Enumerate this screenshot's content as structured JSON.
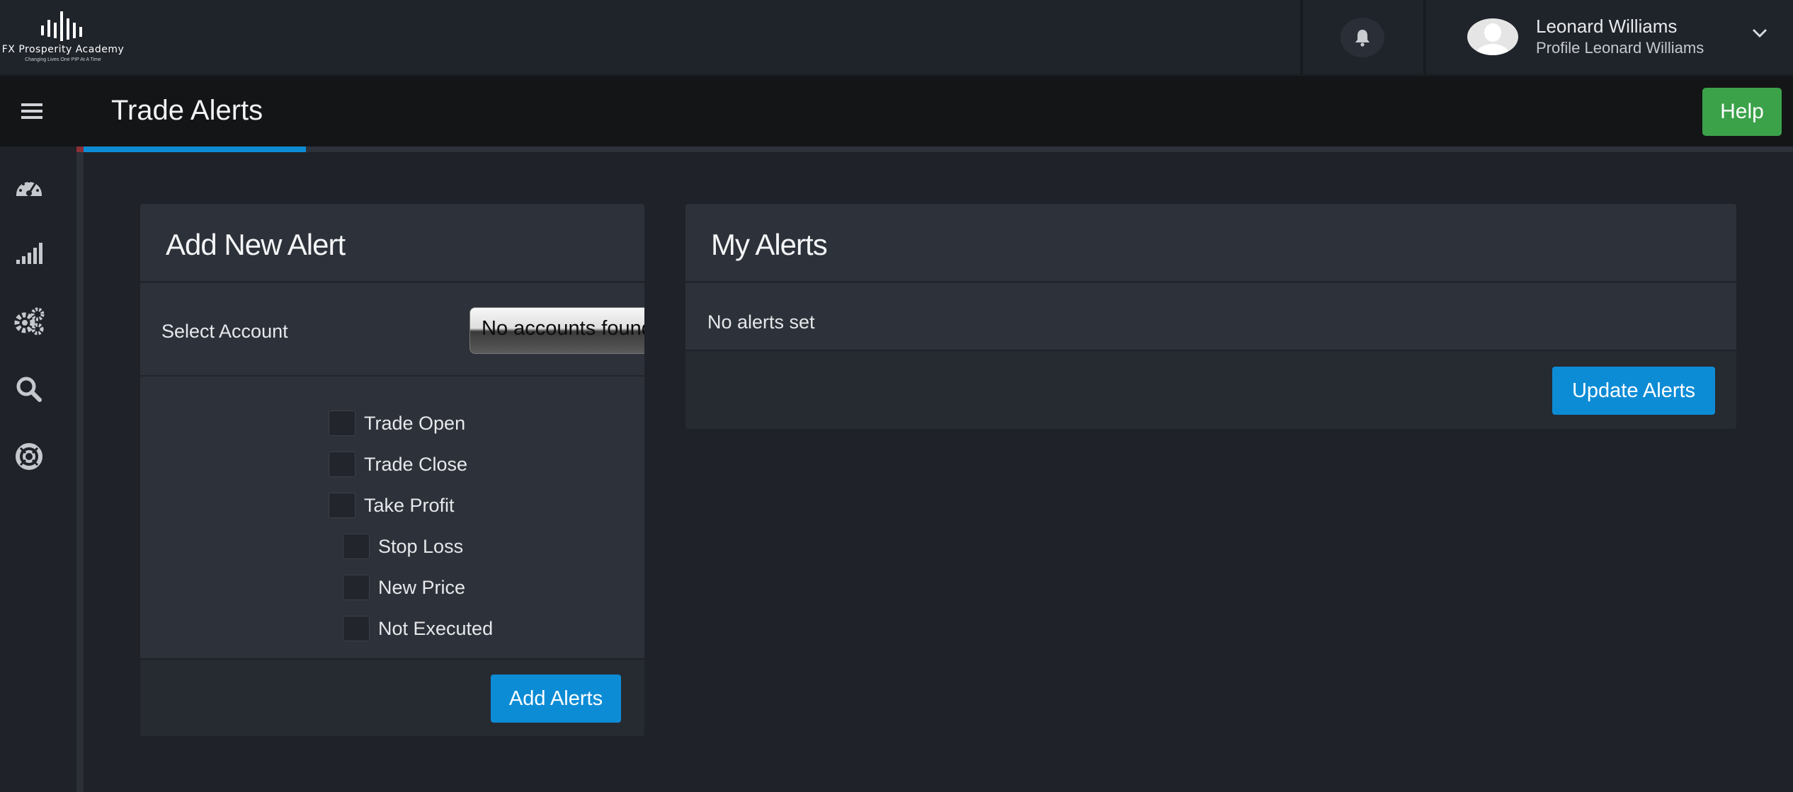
{
  "brand": {
    "name": "FX Prosperity Academy",
    "tagline": "Changing Lives One PIP At A Time"
  },
  "header": {
    "bell_icon": "bell-icon",
    "user_name": "Leonard Williams",
    "user_subtitle": "Profile Leonard Williams"
  },
  "title_bar": {
    "title": "Trade Alerts",
    "help_label": "Help",
    "progress_fraction": 0.13
  },
  "sidebar": {
    "items": [
      {
        "icon": "dashboard-gauge-icon"
      },
      {
        "icon": "signal-bars-icon"
      },
      {
        "icon": "settings-gears-icon"
      },
      {
        "icon": "search-icon"
      },
      {
        "icon": "lifebuoy-support-icon"
      }
    ]
  },
  "add_alert": {
    "title": "Add New Alert",
    "account_label": "Select Account",
    "account_selected": "No accounts found",
    "checkboxes": [
      "Trade Open",
      "Trade Close",
      "Take Profit",
      "Stop Loss",
      "New Price",
      "Not Executed"
    ],
    "button_label": "Add Alerts"
  },
  "my_alerts": {
    "title": "My Alerts",
    "empty_text": "No alerts set",
    "button_label": "Update Alerts"
  },
  "colors": {
    "accent_blue": "#0d8cd6",
    "help_green": "#3ba24a",
    "background": "#1f2228",
    "card": "#2d3139"
  }
}
